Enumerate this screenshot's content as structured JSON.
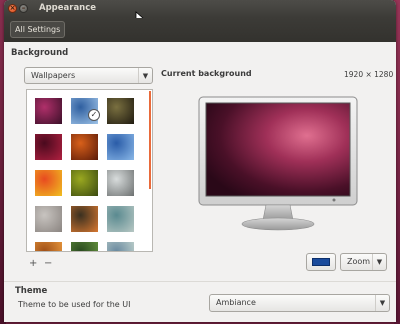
{
  "window": {
    "title": "Appearance"
  },
  "toolbar": {
    "all_settings_label": "All Settings"
  },
  "background": {
    "heading": "Background",
    "source_selected": "Wallpapers",
    "current_heading": "Current background",
    "resolution": "1920 × 1280",
    "add_label": "+",
    "remove_label": "−",
    "color_hex": "#1a4b9c",
    "placement_selected": "Zoom",
    "thumbnails": [
      {
        "colors": [
          "#b0306a",
          "#3a0f28"
        ]
      },
      {
        "colors": [
          "#2f5fa0",
          "#9fc4e8"
        ],
        "selected": true
      },
      {
        "colors": [
          "#7a7040",
          "#1f1a10"
        ]
      },
      {
        "colors": [
          "#4a0a1e",
          "#b02040"
        ]
      },
      {
        "colors": [
          "#d8601a",
          "#5a1a08"
        ]
      },
      {
        "colors": [
          "#2a5ca8",
          "#8ab8e8"
        ]
      },
      {
        "colors": [
          "#e84a20",
          "#f0c020"
        ]
      },
      {
        "colors": [
          "#9aa820",
          "#3a4a10"
        ]
      },
      {
        "colors": [
          "#d8dcdc",
          "#6c7070"
        ]
      },
      {
        "colors": [
          "#c8c4c0",
          "#8a8480"
        ]
      },
      {
        "colors": [
          "#3a3020",
          "#d87830"
        ]
      },
      {
        "colors": [
          "#5a8a90",
          "#b8c8c4"
        ]
      },
      {
        "colors": [
          "#a05018",
          "#f0a040"
        ]
      },
      {
        "colors": [
          "#2a4a20",
          "#6a9a40"
        ]
      },
      {
        "colors": [
          "#6a8aa0",
          "#c8d8d0"
        ]
      }
    ]
  },
  "theme": {
    "heading": "Theme",
    "description": "Theme to be used for the UI",
    "selected": "Ambiance"
  }
}
